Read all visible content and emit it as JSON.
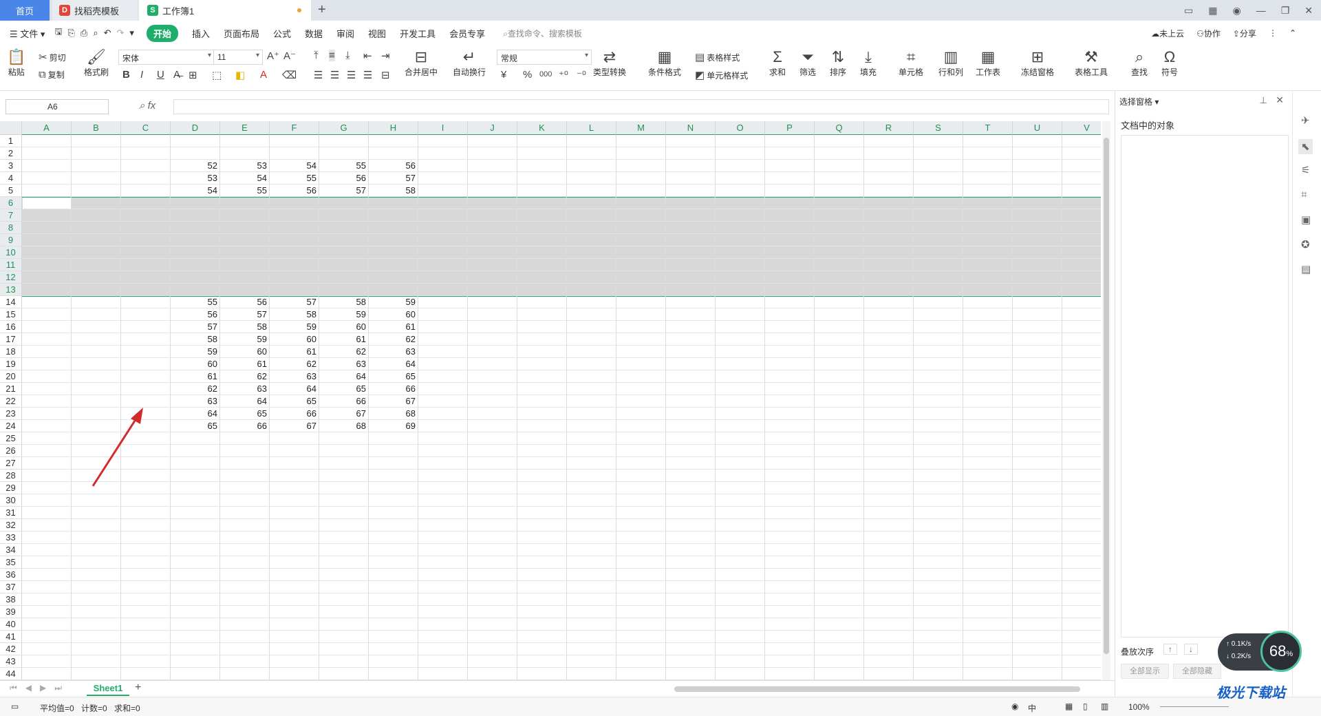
{
  "tabs": [
    {
      "label": "首页"
    },
    {
      "label": "找稻壳模板",
      "icon": "docer-icon"
    },
    {
      "label": "工作簿1",
      "icon": "sheet-icon"
    }
  ],
  "menu": {
    "file": "文件",
    "items": [
      "开始",
      "插入",
      "页面布局",
      "公式",
      "数据",
      "审阅",
      "视图",
      "开发工具",
      "会员专享"
    ],
    "search_placeholder": "查找命令、搜索模板",
    "right": [
      "未上云",
      "协作",
      "分享"
    ]
  },
  "toolbar": {
    "paste": "粘贴",
    "cut": "剪切",
    "copy": "复制",
    "format_painter": "格式刷",
    "font_name": "宋体",
    "font_size": "11",
    "merge_center": "合并居中",
    "wrap_text": "自动换行",
    "number_format": "常规",
    "type_convert": "类型转换",
    "cond_format": "条件格式",
    "table_style": "表格样式",
    "cell_style": "单元格样式",
    "sum": "求和",
    "filter": "筛选",
    "sort": "排序",
    "fill": "填充",
    "cell": "单元格",
    "rows_cols": "行和列",
    "worksheet": "工作表",
    "freeze": "冻结窗格",
    "table_tools": "表格工具",
    "find": "查找",
    "symbol": "符号",
    "currency": "¥",
    "percent": "%",
    "thousands": "000"
  },
  "formula": {
    "name_box": "A6",
    "fx": "fx",
    "value": ""
  },
  "columns": [
    "A",
    "B",
    "C",
    "D",
    "E",
    "F",
    "G",
    "H",
    "I",
    "J",
    "K",
    "L",
    "M",
    "N",
    "O",
    "P",
    "Q",
    "R",
    "S",
    "T",
    "U",
    "V"
  ],
  "rows": [
    "1",
    "2",
    "3",
    "4",
    "5",
    "6",
    "7",
    "8",
    "9",
    "10",
    "11",
    "12",
    "13",
    "14",
    "15",
    "16",
    "17",
    "18",
    "19",
    "20",
    "21",
    "22",
    "23",
    "24",
    "25",
    "26",
    "27",
    "28",
    "29",
    "30",
    "31",
    "32",
    "33",
    "34",
    "35",
    "36",
    "37",
    "38",
    "39",
    "40",
    "41",
    "42",
    "43",
    "44"
  ],
  "cells": [
    {
      "r": 3,
      "vals": [
        "52",
        "53",
        "54",
        "55",
        "56"
      ]
    },
    {
      "r": 4,
      "vals": [
        "53",
        "54",
        "55",
        "56",
        "57"
      ]
    },
    {
      "r": 5,
      "vals": [
        "54",
        "55",
        "56",
        "57",
        "58"
      ]
    },
    {
      "r": 14,
      "vals": [
        "55",
        "56",
        "57",
        "58",
        "59"
      ]
    },
    {
      "r": 15,
      "vals": [
        "56",
        "57",
        "58",
        "59",
        "60"
      ]
    },
    {
      "r": 16,
      "vals": [
        "57",
        "58",
        "59",
        "60",
        "61"
      ]
    },
    {
      "r": 17,
      "vals": [
        "58",
        "59",
        "60",
        "61",
        "62"
      ]
    },
    {
      "r": 18,
      "vals": [
        "59",
        "60",
        "61",
        "62",
        "63"
      ]
    },
    {
      "r": 19,
      "vals": [
        "60",
        "61",
        "62",
        "63",
        "64"
      ]
    },
    {
      "r": 20,
      "vals": [
        "61",
        "62",
        "63",
        "64",
        "65"
      ]
    },
    {
      "r": 21,
      "vals": [
        "62",
        "63",
        "64",
        "65",
        "66"
      ]
    },
    {
      "r": 22,
      "vals": [
        "63",
        "64",
        "65",
        "66",
        "67"
      ]
    },
    {
      "r": 23,
      "vals": [
        "64",
        "65",
        "66",
        "67",
        "68"
      ]
    },
    {
      "r": 24,
      "vals": [
        "65",
        "66",
        "67",
        "68",
        "69"
      ]
    }
  ],
  "selected_rows": [
    "6",
    "13"
  ],
  "sheet": {
    "name": "Sheet1"
  },
  "status": {
    "avg": "平均值=0",
    "count": "计数=0",
    "sum": "求和=0",
    "zoom": "100%",
    "ime": "中"
  },
  "panel": {
    "title": "选择窗格",
    "subtitle": "文档中的对象",
    "order_label": "叠放次序",
    "show_all": "全部显示",
    "hide_all": "全部隐藏"
  },
  "gauge": {
    "percent": "68",
    "unit": "%",
    "up": "0.1",
    "down": "0.2",
    "rate_unit": "K/s"
  },
  "watermark": "极光下载站",
  "colors": {
    "accent": "#1fae6a",
    "home_tab": "#4a86e8",
    "selection": "#d8d8d8"
  }
}
